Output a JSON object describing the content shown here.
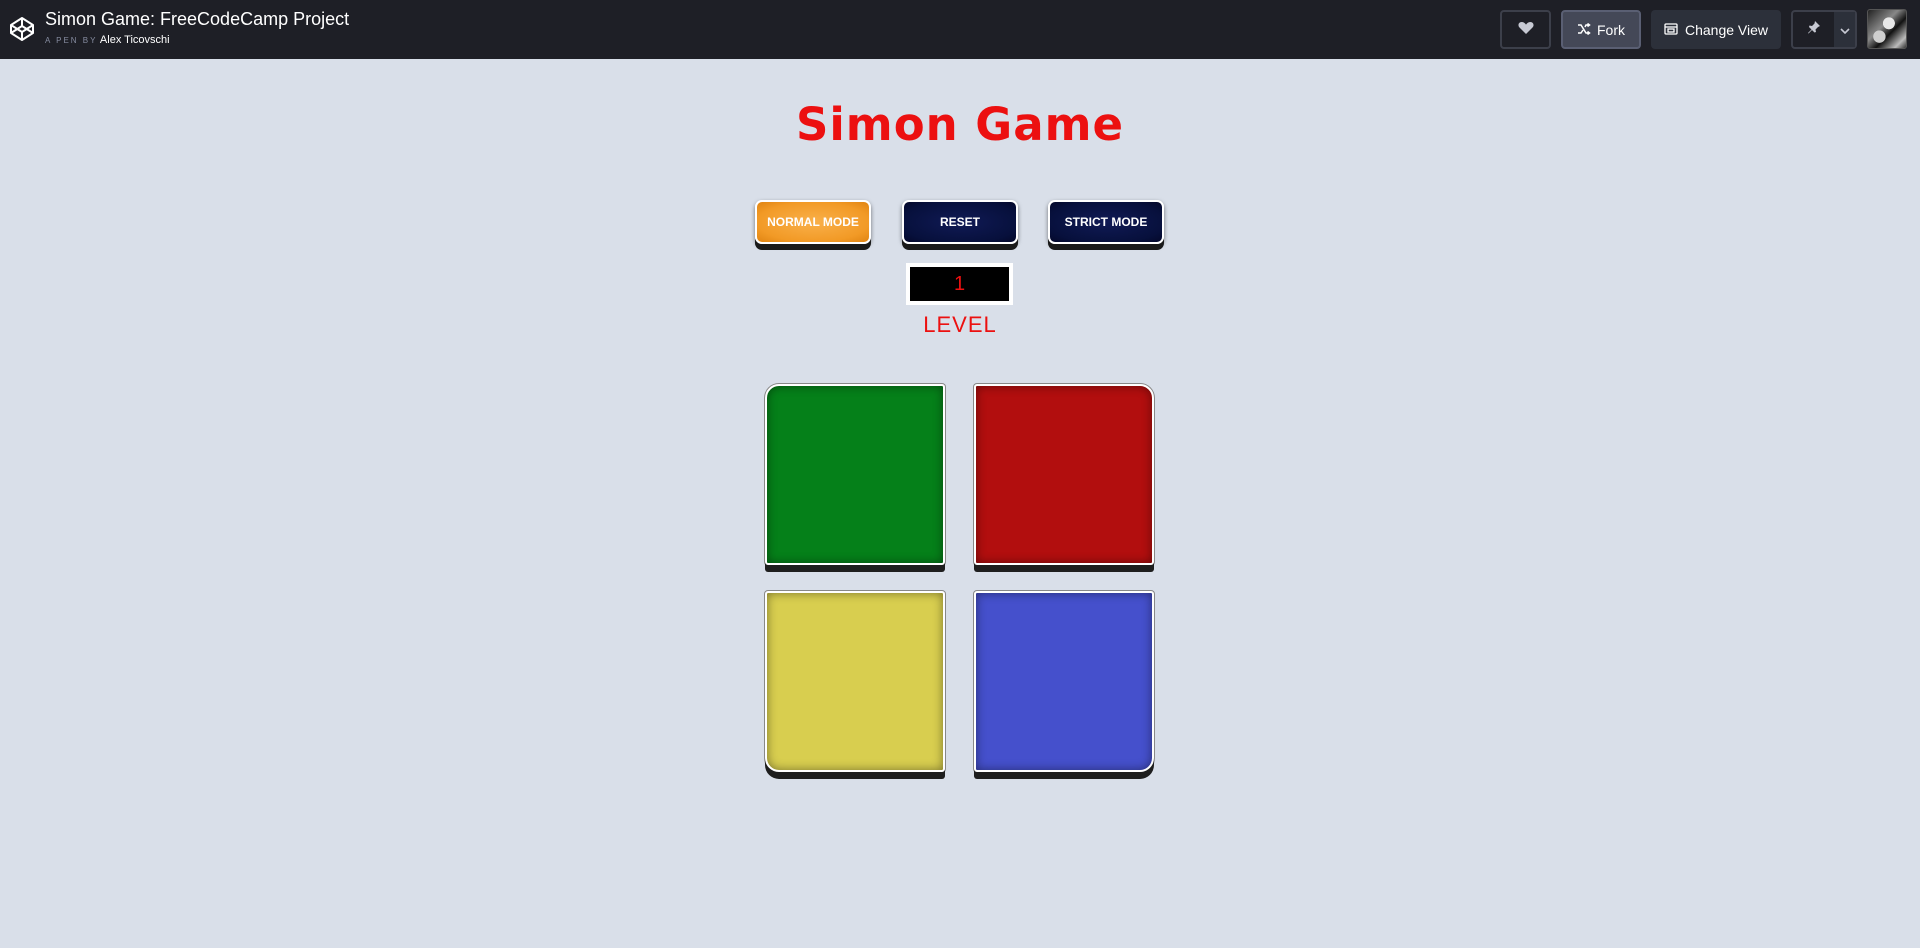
{
  "header": {
    "title": "Simon Game: FreeCodeCamp Project",
    "by_label": "A PEN BY",
    "author": "Alex Ticovschi",
    "fork_label": "Fork",
    "change_view_label": "Change View",
    "icons": {
      "logo": "codepen-logo-icon",
      "heart": "heart-icon",
      "fork": "fork-icon",
      "change_view": "change-view-icon",
      "pin": "pin-icon",
      "dropdown": "chevron-down-icon"
    }
  },
  "game": {
    "title": "Simon Game",
    "buttons": {
      "normal": "NORMAL MODE",
      "reset": "RESET",
      "strict": "STRICT MODE"
    },
    "level_value": "1",
    "level_label": "LEVEL",
    "pads": [
      {
        "color_name": "green",
        "color": "#058019"
      },
      {
        "color_name": "red",
        "color": "#b20e0e"
      },
      {
        "color_name": "yellow",
        "color": "#d8ce4f"
      },
      {
        "color_name": "blue",
        "color": "#4550cc"
      }
    ],
    "accent_color": "#ec1010",
    "active_mode_color": "#f29a26"
  }
}
